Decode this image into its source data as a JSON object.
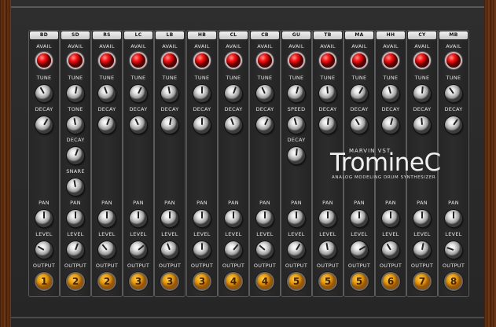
{
  "brand": "MARVIN VST",
  "title": "TromineC",
  "subtitle": "ANALOG MODELING DRUM SYNTHESIZER",
  "row_labels": {
    "avail": "AVAIL",
    "tune": "TUNE",
    "decay": "DECAY",
    "pan": "PAN",
    "level": "LEVEL",
    "output": "OUTPUT"
  },
  "channels": [
    {
      "name": "BD",
      "output": "1",
      "extra": {
        "label": "DECAY"
      }
    },
    {
      "name": "SD",
      "output": "2",
      "extra": {
        "label": "TONE"
      },
      "sd_decay": "DECAY",
      "sd_snare": "SNARE"
    },
    {
      "name": "RS",
      "output": "2",
      "extra": {
        "label": "DECAY"
      }
    },
    {
      "name": "LC",
      "output": "3",
      "extra": {
        "label": "DECAY"
      }
    },
    {
      "name": "LB",
      "output": "3",
      "extra": {
        "label": "DECAY"
      }
    },
    {
      "name": "HB",
      "output": "3",
      "extra": {
        "label": "DECAY"
      }
    },
    {
      "name": "CL",
      "output": "4",
      "extra": {
        "label": "DECAY"
      }
    },
    {
      "name": "CB",
      "output": "4",
      "extra": {
        "label": "DECAY"
      }
    },
    {
      "name": "GU",
      "output": "5",
      "extra": {
        "label": "SPEED"
      },
      "gu_decay": "DECAY"
    },
    {
      "name": "TB",
      "output": "5",
      "extra": {
        "label": "DECAY"
      }
    },
    {
      "name": "MA",
      "output": "5",
      "extra": {
        "label": "DECAY"
      }
    },
    {
      "name": "HH",
      "output": "6",
      "extra": {
        "label": "DECAY"
      }
    },
    {
      "name": "CY",
      "output": "7",
      "extra": {
        "label": "DECAY"
      }
    },
    {
      "name": "MB",
      "output": "8",
      "extra": {
        "label": "DECAY"
      }
    }
  ]
}
